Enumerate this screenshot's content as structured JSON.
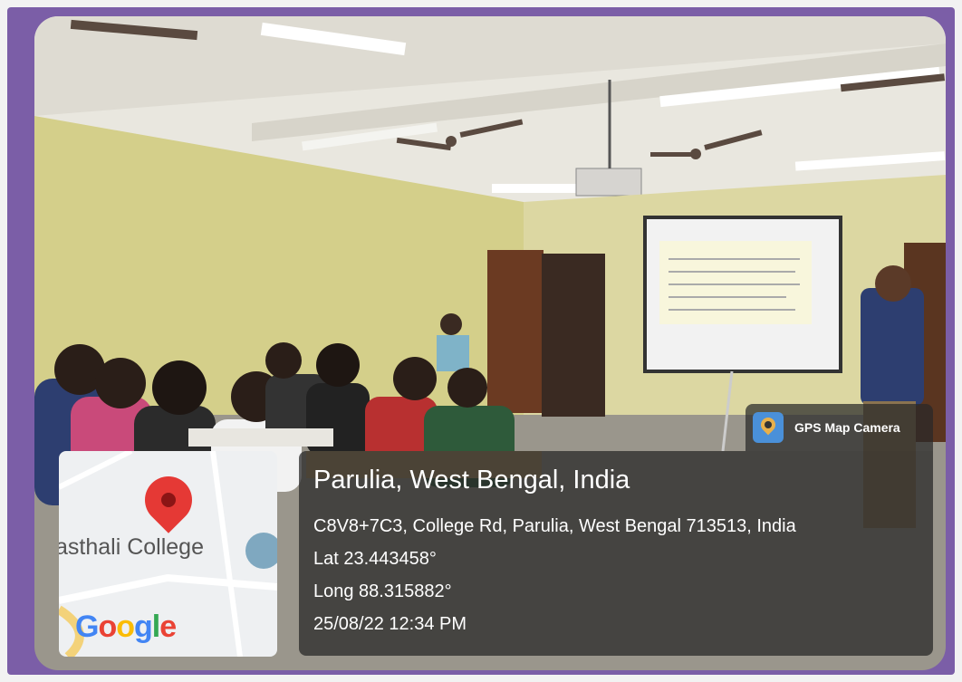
{
  "overlay": {
    "app_name": "GPS Map Camera",
    "place": "Parulia, West Bengal, India",
    "address": "C8V8+7C3, College Rd, Parulia, West Bengal 713513, India",
    "latitude": "Lat 23.443458°",
    "longitude": "Long 88.315882°",
    "timestamp": "25/08/22 12:34 PM"
  },
  "map": {
    "label": "asthali College",
    "logo_text": [
      "G",
      "o",
      "o",
      "g",
      "l",
      "e"
    ],
    "logo_colors": [
      "#4285F4",
      "#EA4335",
      "#FBBC05",
      "#4285F4",
      "#34A853",
      "#EA4335"
    ]
  },
  "colors": {
    "frame": "#7b5ea7",
    "wall": "#d4cf8a"
  }
}
